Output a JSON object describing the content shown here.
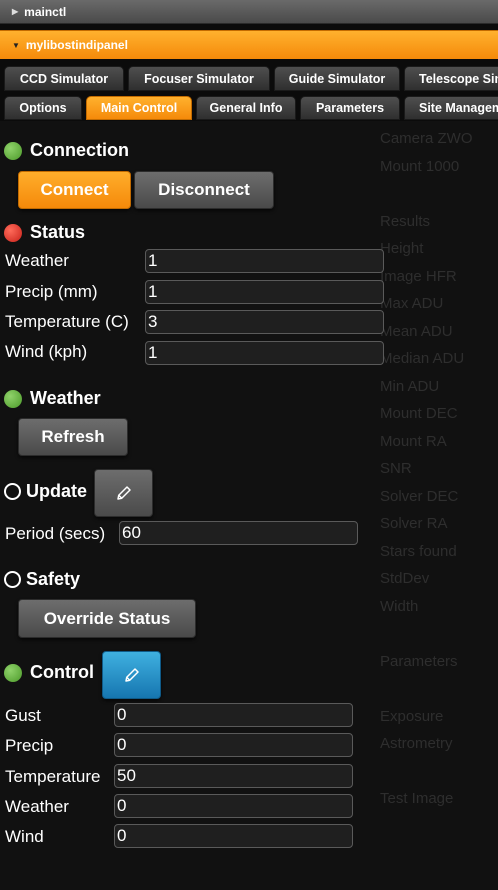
{
  "panels": {
    "collapsed_label": "mainctl",
    "active_label": "mylibostindipanel"
  },
  "device_tabs": [
    "CCD Simulator",
    "Focuser Simulator",
    "Guide Simulator",
    "Telescope Sim"
  ],
  "group_tabs": [
    "Options",
    "Main Control",
    "General Info",
    "Parameters",
    "Site Managem"
  ],
  "active_group_tab": "Main Control",
  "connection": {
    "title": "Connection",
    "state": "ok",
    "connect_label": "Connect",
    "disconnect_label": "Disconnect"
  },
  "status": {
    "title": "Status",
    "state": "alert",
    "rows": [
      {
        "label": "Weather",
        "value": "1"
      },
      {
        "label": "Precip (mm)",
        "value": "1"
      },
      {
        "label": "Temperature (C)",
        "value": "3"
      },
      {
        "label": "Wind (kph)",
        "value": "1"
      }
    ]
  },
  "weather": {
    "title": "Weather",
    "state": "ok",
    "refresh_label": "Refresh"
  },
  "update": {
    "title": "Update",
    "state": "idle",
    "period_label": "Period (secs)",
    "period_value": "60"
  },
  "safety": {
    "title": "Safety",
    "state": "idle",
    "override_label": "Override Status"
  },
  "control": {
    "title": "Control",
    "state": "ok",
    "rows": [
      {
        "label": "Gust",
        "value": "0"
      },
      {
        "label": "Precip",
        "value": "0"
      },
      {
        "label": "Temperature",
        "value": "50"
      },
      {
        "label": "Weather",
        "value": "0"
      },
      {
        "label": "Wind",
        "value": "0"
      }
    ]
  },
  "background_panel_text": [
    "Camera ZWO",
    "Mount 1000",
    "",
    "Results",
    "Height",
    "Image HFR",
    "Max ADU",
    "Mean ADU",
    "Median ADU",
    "Min ADU",
    "Mount DEC",
    "Mount RA",
    "SNR",
    "Solver DEC",
    "Solver RA",
    "Stars found",
    "StdDev",
    "Width",
    "",
    "Parameters",
    "",
    "Exposure",
    "Astrometry",
    "",
    "Test Image"
  ],
  "colors": {
    "accent_orange": "#f58a0a",
    "ok_green": "#5aa832",
    "alert_red": "#d7261d",
    "edit_blue": "#1b86c4"
  },
  "icons": {
    "edit": "pencil-icon",
    "collapsed": "triangle-right-icon",
    "expanded": "triangle-down-icon"
  }
}
